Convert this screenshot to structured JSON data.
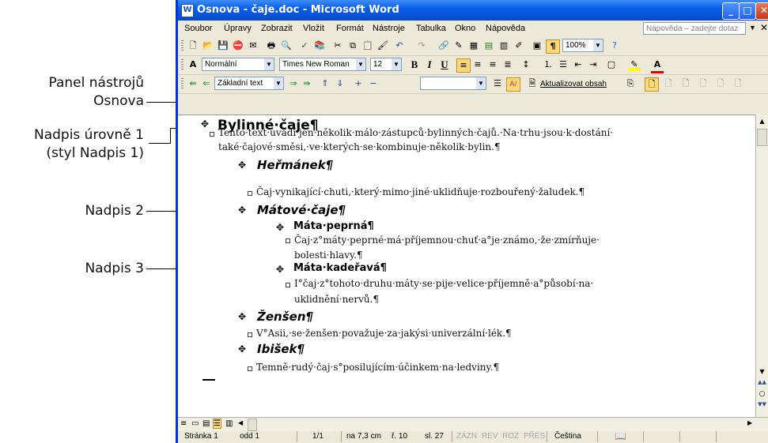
{
  "callouts": {
    "toolbar": [
      "Panel nástrojů",
      "Osnova"
    ],
    "heading1": [
      "Nadpis úrovně 1",
      "(styl Nadpis 1)"
    ],
    "heading2": "Nadpis 2",
    "heading3": "Nadpis 3"
  },
  "window": {
    "title": "Osnova - čaje.doc - Microsoft Word",
    "app_icon": "W",
    "buttons": [
      "minimize",
      "maximize",
      "close"
    ]
  },
  "menu": [
    "Soubor",
    "Úpravy",
    "Zobrazit",
    "Vložit",
    "Formát",
    "Nástroje",
    "Tabulka",
    "Okno",
    "Nápověda"
  ],
  "help_box": {
    "placeholder": "Nápověda – zadejte dotaz"
  },
  "formatting": {
    "style": "Normální",
    "font": "Times New Roman",
    "size": "12",
    "zoom": "100%",
    "bold": "B",
    "italic": "I",
    "underline": "U",
    "font_color_letter": "A"
  },
  "outline_toolbar": {
    "level": "Základní text",
    "update_toc": "Aktualizovat obsah"
  },
  "document": {
    "h1": "Bylinné·čaje¶",
    "intro": [
      "Tento·text·uvádí·jen·několik·málo·zástupců·bylinných·čajů.·Na·trhu·jsou·k·dostání·",
      "také·čajové·směsi,·ve·kterých·se·kombinuje·několik·bylin.¶"
    ],
    "heřmánek": "Heřmánek¶",
    "heřmánek_text": "Čaj·vynikající·chuti,·který·mimo·jiné·uklidňuje·rozbouřený·žaludek.¶",
    "mata": "Mátové·čaje¶",
    "mata_peprna": "Máta·peprná¶",
    "mata_peprna_text": [
      "Čaj·z°máty·peprné·má·příjemnou·chuť·a°je·známo,·že·zmírňuje·",
      "bolesti·hlavy.¶"
    ],
    "mata_kaderava": "Máta·kadeřavá¶",
    "mata_kaderava_text": [
      "I°čaj·z°tohoto·druhu·máty·se·pije·velice·příjemně·a°působí·na·",
      "uklidnění·nervů.¶"
    ],
    "zensen": "Ženšen¶",
    "zensen_text": "V°Asii,·se·ženšen·považuje·za·jakýsi·univerzální·lék.¶",
    "ibisek": "Ibišek¶",
    "ibisek_text": "Temně·rudý·čaj·s°posilujícím·účinkem·na·ledviny.¶"
  },
  "status": {
    "page": "Stránka 1",
    "section": "odd 1",
    "pages": "1/1",
    "position": "na 7,3 cm",
    "line": "ř. 10",
    "column": "sl. 27",
    "rec": "ZÁZN",
    "rev": "REV",
    "ext": "ROZ",
    "ovr": "PŘES",
    "language": "Čeština"
  },
  "colors": {
    "titlebar": "#0a5fe4",
    "chrome": "#ece9d8",
    "callout_line": "#000000"
  }
}
